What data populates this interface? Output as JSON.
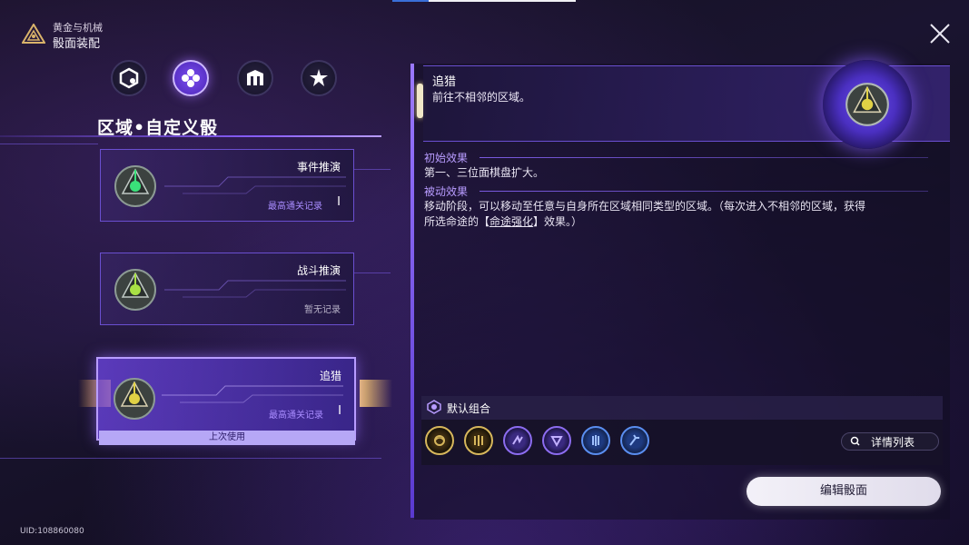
{
  "header": {
    "mode": "黄金与机械",
    "title": "骰面装配"
  },
  "categories": [
    {
      "icon": "dice-icon",
      "active": false
    },
    {
      "icon": "hex-cluster-icon",
      "active": true
    },
    {
      "icon": "tower-icon",
      "active": false
    },
    {
      "icon": "starburst-icon",
      "active": false
    }
  ],
  "section_title": "区域•自定义骰",
  "dice_cards": [
    {
      "name": "事件推演",
      "record": "最高通关记录",
      "die_color": "#3ae07a"
    },
    {
      "name": "战斗推演",
      "record": "暂无记录",
      "die_color": "#a8e045"
    },
    {
      "name": "追猎",
      "record": "最高通关记录",
      "die_color": "#e0d145",
      "selected": true,
      "badge": "上次使用"
    }
  ],
  "detail": {
    "name": "追猎",
    "description": "前往不相邻的区域。",
    "initial_effect_title": "初始效果",
    "initial_effect_text": "第一、三位面棋盘扩大。",
    "passive_effect_title": "被动效果",
    "passive_effect_line1": "移动阶段，可以移动至任意与自身所在区域相同类型的区域。（每次进入不相邻的区域，获得",
    "passive_effect_line2_pre": "所选命途的【",
    "passive_effect_keyword": "命途强化",
    "passive_effect_line2_post": "】效果。）"
  },
  "combo": {
    "label": "默认组合",
    "icons": [
      {
        "name": "abundance-path-icon",
        "tone": "gold"
      },
      {
        "name": "erudition-path-icon",
        "tone": "gold"
      },
      {
        "name": "nihility-path-icon",
        "tone": "purple"
      },
      {
        "name": "elation-path-icon",
        "tone": "purple"
      },
      {
        "name": "hunt-path-icon",
        "tone": "blue"
      },
      {
        "name": "preservation-path-icon",
        "tone": "blue"
      }
    ],
    "details_button": "详情列表"
  },
  "edit_button": "编辑骰面",
  "uid": "UID:108860080"
}
